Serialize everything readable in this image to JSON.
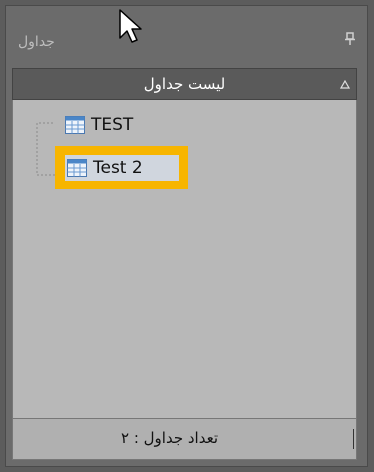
{
  "panel": {
    "title": "جداول",
    "pin_icon": "pin-icon"
  },
  "list": {
    "header": "لیست جداول",
    "collapse_icon": "collapse-triangle-icon",
    "items": [
      {
        "label": "TEST",
        "icon": "table-icon",
        "selected": false
      },
      {
        "label": "Test 2",
        "icon": "table-icon",
        "selected": true
      }
    ],
    "highlight_color": "#f7b500"
  },
  "footer": {
    "count_text": "تعداد جداول : ۲"
  },
  "cursor": "mouse-pointer-icon"
}
